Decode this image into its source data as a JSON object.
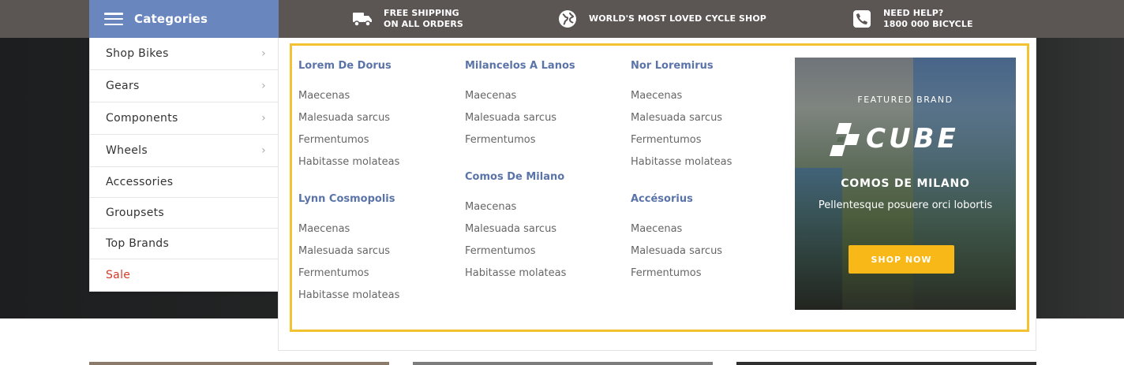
{
  "header": {
    "categories_label": "Categories",
    "shipping": {
      "line1": "FREE SHIPPING",
      "line2": "ON ALL ORDERS",
      "icon": "truck-icon"
    },
    "shop": {
      "line1": "WORLD'S MOST LOVED CYCLE SHOP",
      "icon": "globe-icon"
    },
    "help": {
      "line1": "NEED HELP?",
      "line2": "1800 000 BICYCLE",
      "icon": "phone-icon"
    }
  },
  "sidebar": {
    "items": [
      {
        "label": "Shop Bikes",
        "has_submenu": true
      },
      {
        "label": "Gears",
        "has_submenu": true
      },
      {
        "label": "Components",
        "has_submenu": true
      },
      {
        "label": "Wheels",
        "has_submenu": true
      },
      {
        "label": "Accessories",
        "has_submenu": false
      },
      {
        "label": "Groupsets",
        "has_submenu": false
      },
      {
        "label": "Top Brands",
        "has_submenu": false
      },
      {
        "label": "Sale",
        "has_submenu": false
      }
    ]
  },
  "mega_menu": {
    "columns": [
      {
        "groups": [
          {
            "heading": "Lorem De Dorus",
            "links": [
              "Maecenas",
              "Malesuada sarcus",
              "Fermentumos",
              "Habitasse molateas"
            ]
          },
          {
            "heading": "Lynn Cosmopolis",
            "links": [
              "Maecenas",
              "Malesuada sarcus",
              "Fermentumos",
              "Habitasse molateas"
            ]
          }
        ]
      },
      {
        "groups": [
          {
            "heading": "Milancelos A Lanos",
            "links": [
              "Maecenas",
              "Malesuada sarcus",
              "Fermentumos"
            ]
          },
          {
            "heading": "Comos De Milano",
            "links": [
              "Maecenas",
              "Malesuada sarcus",
              "Fermentumos",
              "Habitasse molateas"
            ]
          }
        ]
      },
      {
        "groups": [
          {
            "heading": "Nor Loremirus",
            "links": [
              "Maecenas",
              "Malesuada sarcus",
              "Fermentumos",
              "Habitasse molateas"
            ]
          },
          {
            "heading": "Accésorius",
            "links": [
              "Maecenas",
              "Malesuada sarcus",
              "Fermentumos"
            ]
          }
        ]
      }
    ],
    "banner": {
      "featured_label": "FEATURED BRAND",
      "brand_logo_text": "CUBE",
      "title": "COMOS DE MILANO",
      "subtitle": "Pellentesque posuere orci lobortis",
      "button_label": "SHOP NOW"
    }
  },
  "colors": {
    "topbar": "#5b5553",
    "categories_bg": "#6a86bf",
    "heading": "#5b74a8",
    "sale": "#d43a2a",
    "frame": "#f2c230",
    "button": "#f8b818"
  }
}
